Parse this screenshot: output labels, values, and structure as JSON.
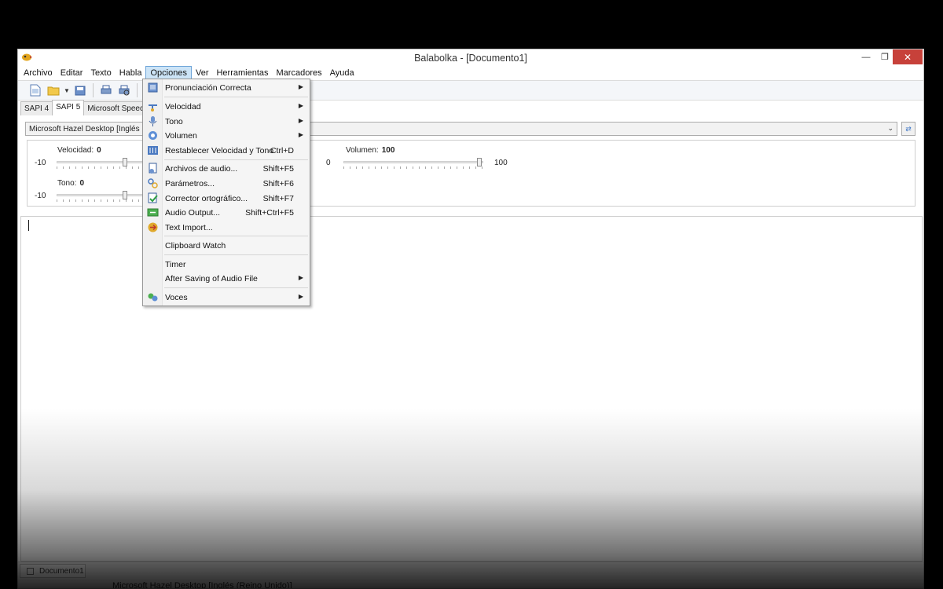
{
  "window": {
    "title": "Balabolka - [Documento1]"
  },
  "menubar": [
    {
      "label": "Archivo"
    },
    {
      "label": "Editar"
    },
    {
      "label": "Texto"
    },
    {
      "label": "Habla"
    },
    {
      "label": "Opciones",
      "active": true
    },
    {
      "label": "Ver"
    },
    {
      "label": "Herramientas"
    },
    {
      "label": "Marcadores"
    },
    {
      "label": "Ayuda"
    }
  ],
  "tabs": [
    {
      "label": "SAPI 4"
    },
    {
      "label": "SAPI 5",
      "selected": true
    },
    {
      "label": "Microsoft Speech P"
    }
  ],
  "voice": {
    "selected": "Microsoft Hazel Desktop [Inglés (Rei"
  },
  "params": {
    "speed_label": "Velocidad:",
    "speed_value": "0",
    "speed_min": "-10",
    "pitch_label": "Tono:",
    "pitch_value": "0",
    "pitch_min": "-10",
    "volume_label": "Volumen:",
    "volume_value": "100",
    "volume_min": "0",
    "volume_max": "100"
  },
  "status": {
    "doc_tab": "Documento1",
    "voice_text": "Microsoft Hazel Desktop [Inglés (Reino Unido)]"
  },
  "options_menu": {
    "pronunciation": {
      "label": "Pronunciación Correcta",
      "icon": "book-icon"
    },
    "speed": {
      "label": "Velocidad",
      "icon": "speedometer-icon"
    },
    "pitch": {
      "label": "Tono",
      "icon": "microphone-icon"
    },
    "volume": {
      "label": "Volumen",
      "icon": "speaker-icon"
    },
    "reset": {
      "label": "Restablecer Velocidad y Tono",
      "shortcut": "Ctrl+D",
      "icon": "sliders-icon"
    },
    "audio_files": {
      "label": "Archivos de audio...",
      "shortcut": "Shift+F5",
      "icon": "audio-file-icon"
    },
    "parameters": {
      "label": "Parámetros...",
      "shortcut": "Shift+F6",
      "icon": "settings-icon"
    },
    "spellcheck": {
      "label": "Corrector ortográfico...",
      "shortcut": "Shift+F7",
      "icon": "spellcheck-icon"
    },
    "audio_output": {
      "label": "Audio Output...",
      "shortcut": "Shift+Ctrl+F5",
      "icon": "audio-output-icon"
    },
    "text_import": {
      "label": "Text Import...",
      "icon": "import-icon"
    },
    "clipboard_watch": {
      "label": "Clipboard Watch"
    },
    "timer": {
      "label": "Timer"
    },
    "after_saving": {
      "label": "After Saving of Audio File"
    },
    "voices": {
      "label": "Voces",
      "icon": "voices-icon"
    }
  }
}
